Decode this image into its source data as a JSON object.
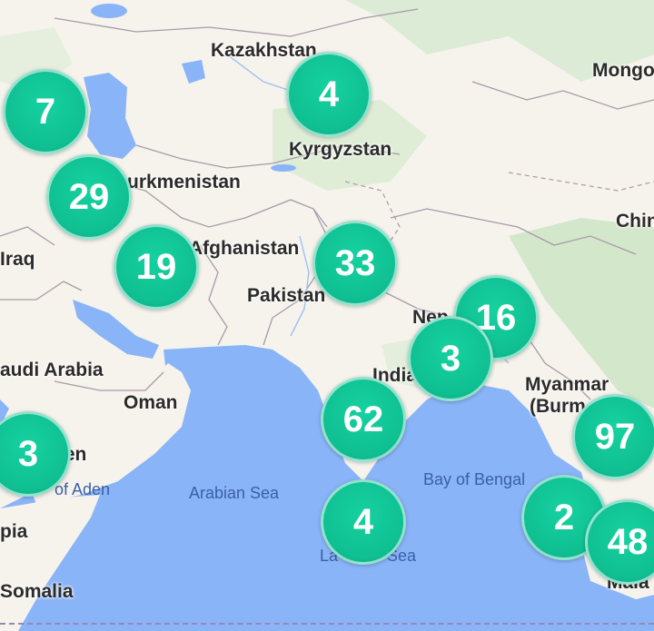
{
  "map": {
    "colors": {
      "land": "#f6f3ec",
      "water": "#8ab4f8",
      "forest": "#cfe6c7",
      "cluster": "#10c493"
    },
    "countries": [
      {
        "id": "kazakhstan",
        "label": "Kazakhstan"
      },
      {
        "id": "mongolia",
        "label": "Mongo"
      },
      {
        "id": "kyrgyzstan",
        "label": "Kyrgyzstan"
      },
      {
        "id": "turkmenistan",
        "label": "urkmenistan"
      },
      {
        "id": "china",
        "label": "Chin"
      },
      {
        "id": "iraq",
        "label": "Iraq"
      },
      {
        "id": "afghanistan",
        "label": "Afghanistan"
      },
      {
        "id": "pakistan",
        "label": "Pakistan"
      },
      {
        "id": "nepal",
        "label": "Nep"
      },
      {
        "id": "saudi-arabia",
        "label": "audi Arabia"
      },
      {
        "id": "india",
        "label": "India"
      },
      {
        "id": "myanmar",
        "label": "Myanmar"
      },
      {
        "id": "burma",
        "label": "(Burm"
      },
      {
        "id": "oman",
        "label": "Oman"
      },
      {
        "id": "yemen",
        "label": "nen"
      },
      {
        "id": "somalia",
        "label": "Somalia"
      },
      {
        "id": "ethiopia",
        "label": "pia"
      },
      {
        "id": "malaysia",
        "label": "Mala"
      }
    ],
    "seas": [
      {
        "id": "gulf-of-aden",
        "label": "of Aden"
      },
      {
        "id": "arabian-sea",
        "label": "Arabian Sea"
      },
      {
        "id": "bay-of-bengal",
        "label": "Bay of Bengal"
      },
      {
        "id": "laccadive-sea",
        "label": "La      ve Sea"
      }
    ],
    "clusters": [
      {
        "id": "c1",
        "count": "7"
      },
      {
        "id": "c2",
        "count": "4"
      },
      {
        "id": "c3",
        "count": "29"
      },
      {
        "id": "c4",
        "count": "19"
      },
      {
        "id": "c5",
        "count": "33"
      },
      {
        "id": "c6",
        "count": "16"
      },
      {
        "id": "c7",
        "count": "3"
      },
      {
        "id": "c8",
        "count": "62"
      },
      {
        "id": "c9",
        "count": "97"
      },
      {
        "id": "c10",
        "count": "3"
      },
      {
        "id": "c11",
        "count": "4"
      },
      {
        "id": "c12",
        "count": "2"
      },
      {
        "id": "c13",
        "count": "48"
      }
    ]
  }
}
